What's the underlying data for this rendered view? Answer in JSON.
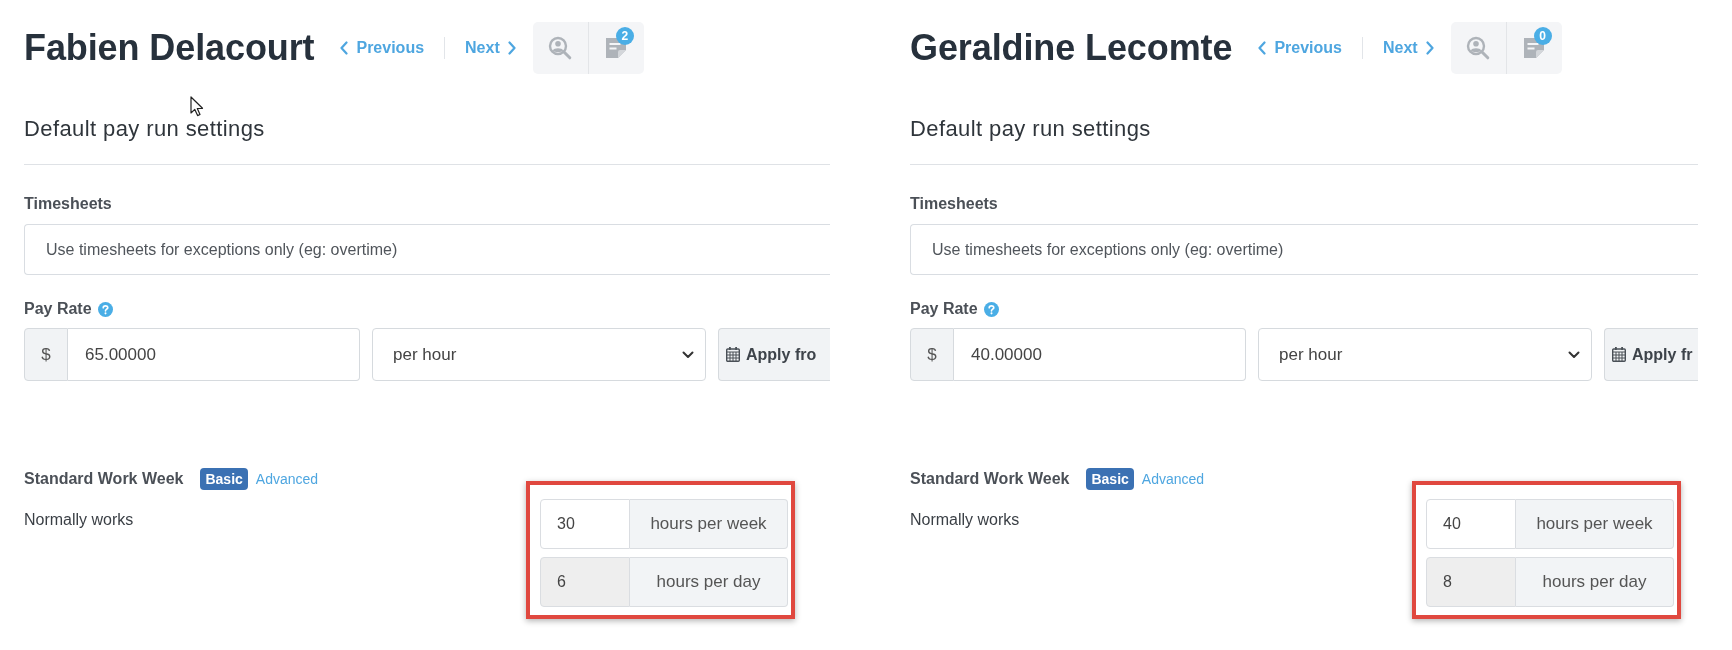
{
  "panels": [
    {
      "employee_name": "Fabien Delacourt",
      "mouse_pointer": true,
      "nav": {
        "previous": "Previous",
        "next": "Next"
      },
      "note_count": "2",
      "section_title": "Default pay run settings",
      "timesheets": {
        "label": "Timesheets",
        "value": "Use timesheets for exceptions only (eg: overtime)"
      },
      "pay_rate": {
        "label": "Pay Rate",
        "currency": "$",
        "amount": "65.00000",
        "unit": "per hour",
        "apply_button": "Apply fro"
      },
      "work_week": {
        "label": "Standard Work Week",
        "modes": [
          {
            "label": "Basic",
            "selected": true
          },
          {
            "label": "Advanced",
            "selected": false
          }
        ],
        "normally_works_label": "Normally works",
        "highlighted": true,
        "hours": [
          {
            "value": "30",
            "unit": "hours per week",
            "disabled": false
          },
          {
            "value": "6",
            "unit": "hours per day",
            "disabled": true
          }
        ]
      }
    },
    {
      "employee_name": "Geraldine Lecomte",
      "mouse_pointer": false,
      "nav": {
        "previous": "Previous",
        "next": "Next"
      },
      "note_count": "0",
      "section_title": "Default pay run settings",
      "timesheets": {
        "label": "Timesheets",
        "value": "Use timesheets for exceptions only (eg: overtime)"
      },
      "pay_rate": {
        "label": "Pay Rate",
        "currency": "$",
        "amount": "40.00000",
        "unit": "per hour",
        "apply_button": "Apply fr"
      },
      "work_week": {
        "label": "Standard Work Week",
        "modes": [
          {
            "label": "Basic",
            "selected": true
          },
          {
            "label": "Advanced",
            "selected": false
          }
        ],
        "normally_works_label": "Normally works",
        "highlighted": true,
        "hours": [
          {
            "value": "40",
            "unit": "hours per week",
            "disabled": false
          },
          {
            "value": "8",
            "unit": "hours per day",
            "disabled": true
          }
        ]
      }
    }
  ]
}
